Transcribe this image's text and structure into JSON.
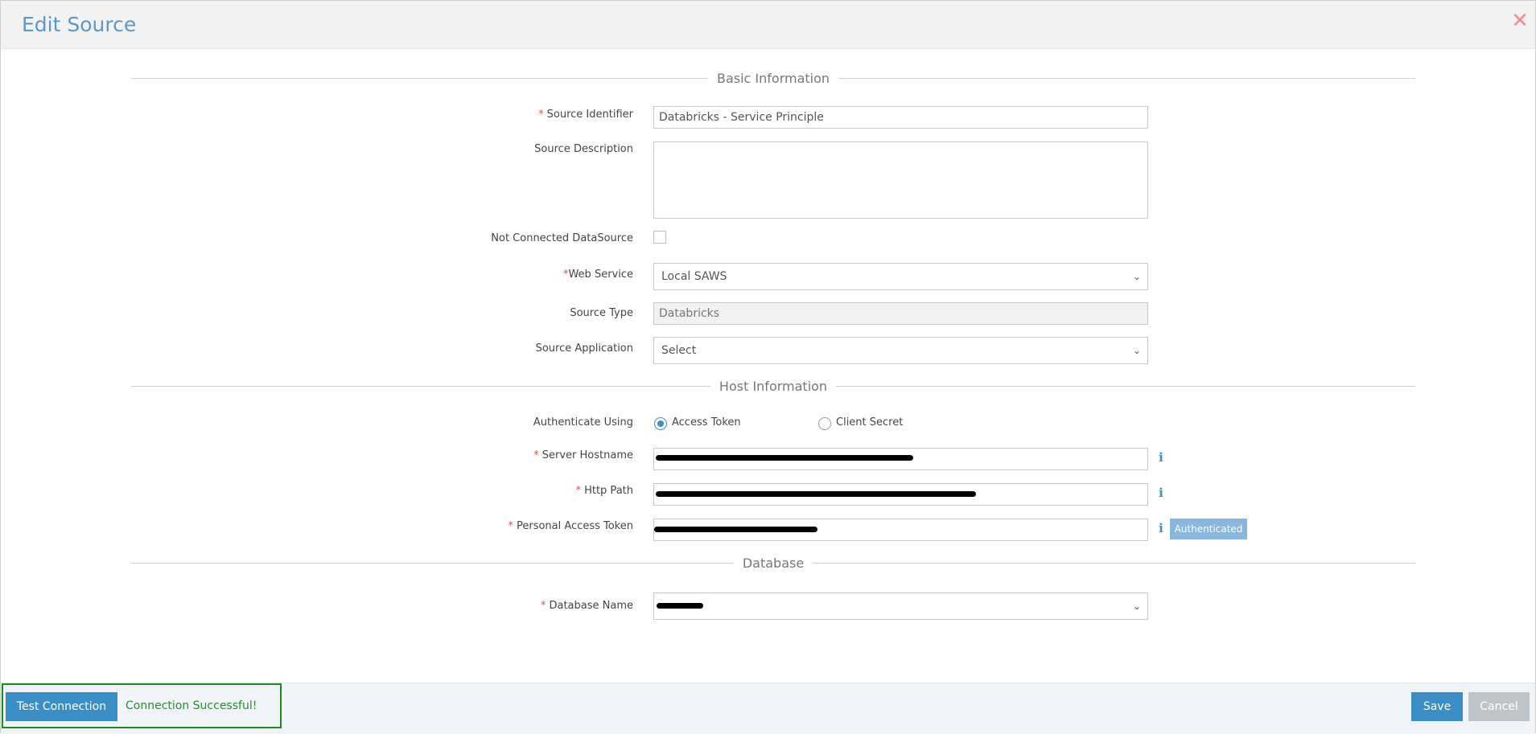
{
  "dialog": {
    "title": "Edit Source",
    "close_icon": "close-icon"
  },
  "sections": {
    "basic": "Basic Information",
    "host": "Host Information",
    "database": "Database"
  },
  "fields": {
    "source_identifier": {
      "label": "Source Identifier",
      "value": "Databricks - Service Principle",
      "required": "*"
    },
    "source_description": {
      "label": "Source Description",
      "value": ""
    },
    "not_connected": {
      "label": "Not Connected DataSource"
    },
    "web_service": {
      "label": "Web Service",
      "value": "Local SAWS",
      "required": "*"
    },
    "source_type": {
      "label": "Source Type",
      "value": "Databricks"
    },
    "source_application": {
      "label": "Source Application",
      "value": "Select"
    },
    "authenticate_using": {
      "label": "Authenticate Using",
      "options": [
        "Access Token",
        "Client Secret"
      ],
      "selected": "Access Token"
    },
    "server_hostname": {
      "label": "Server Hostname",
      "required": "*"
    },
    "http_path": {
      "label": "Http Path",
      "required": "*"
    },
    "personal_access_token": {
      "label": "Personal Access Token",
      "required": "*"
    },
    "database_name": {
      "label": "Database Name",
      "required": "*"
    }
  },
  "badges": {
    "authenticated": "Authenticated"
  },
  "icons": {
    "info": "i",
    "chevron": "⌄",
    "close": "✕"
  },
  "footer": {
    "test_connection": "Test Connection",
    "connection_message": "Connection Successful!",
    "save": "Save",
    "cancel": "Cancel"
  },
  "colors": {
    "accent": "#3b8ec5",
    "success": "#2e8b2e",
    "required": "#d9534f",
    "highlight_border": "#1f8a24"
  }
}
